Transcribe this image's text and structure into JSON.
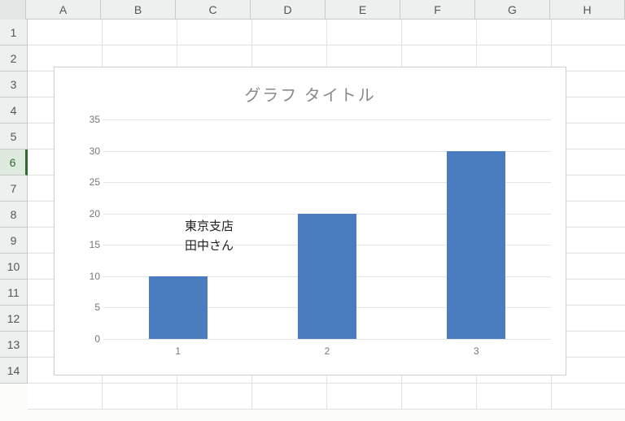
{
  "columns": [
    "A",
    "B",
    "C",
    "D",
    "E",
    "F",
    "G",
    "H"
  ],
  "rows": [
    "1",
    "2",
    "3",
    "4",
    "5",
    "6",
    "7",
    "8",
    "9",
    "10",
    "11",
    "12",
    "13",
    "14"
  ],
  "selected_row": "6",
  "chart_data": {
    "type": "bar",
    "title": "グラフ タイトル",
    "categories": [
      "1",
      "2",
      "3"
    ],
    "values": [
      10,
      20,
      30
    ],
    "xlabel": "",
    "ylabel": "",
    "ylim": [
      0,
      35
    ],
    "y_ticks": [
      0,
      5,
      10,
      15,
      20,
      25,
      30,
      35
    ],
    "annotations": [
      {
        "text_lines": [
          "東京支店",
          "田中さん"
        ],
        "near_category": "1"
      }
    ]
  }
}
